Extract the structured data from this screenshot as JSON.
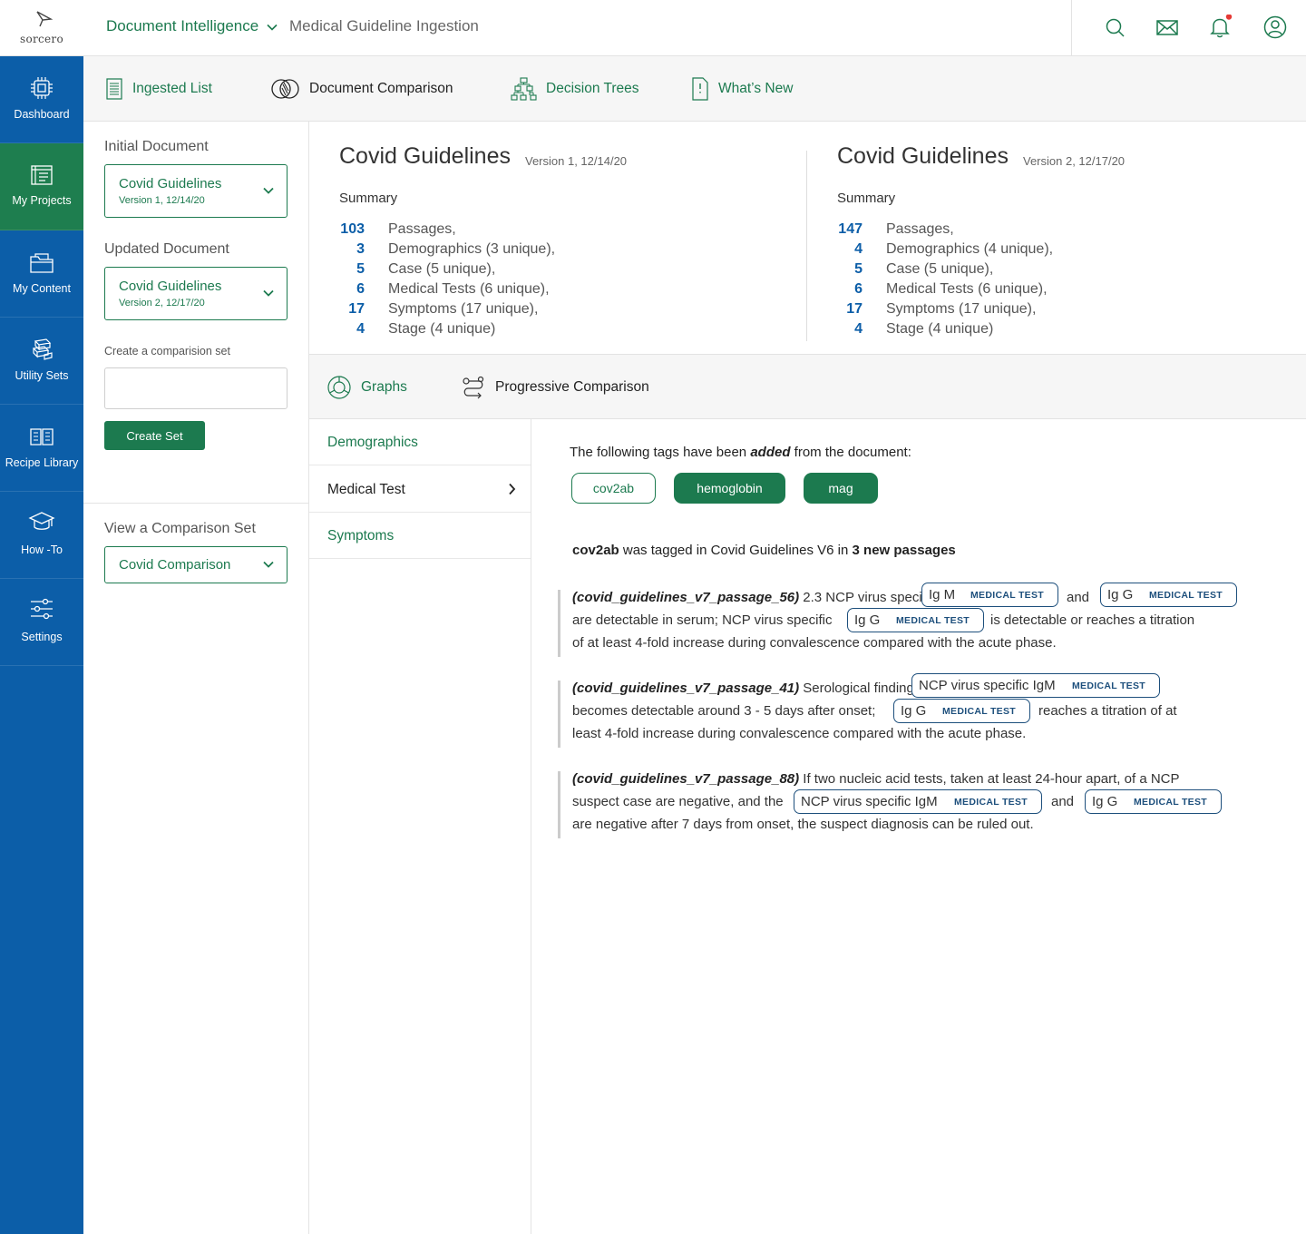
{
  "brand": {
    "logo_text": "sorcero"
  },
  "header": {
    "app_name": "Document Intelligence",
    "page_name": "Medical Guideline Ingestion",
    "icons": [
      "search-icon",
      "mail-icon",
      "bell-icon",
      "user-icon"
    ],
    "notification_dot_color": "#e53935"
  },
  "colors": {
    "brand_green": "#1c7a4f",
    "nav_blue": "#0c5ea8",
    "number_blue": "#0c5ea8",
    "entity_border": "#1d4f7c"
  },
  "nav": {
    "items": [
      {
        "label": "Dashboard",
        "icon": "chip-icon",
        "active": false
      },
      {
        "label": "My Projects",
        "icon": "projects-icon",
        "active": true
      },
      {
        "label": "My Content",
        "icon": "folder-icon",
        "active": false
      },
      {
        "label": "Utility Sets",
        "icon": "stack-icon",
        "active": false
      },
      {
        "label": "Recipe Library",
        "icon": "book-icon",
        "active": false
      },
      {
        "label": "How -To",
        "icon": "graduation-cap-icon",
        "active": false
      },
      {
        "label": "Settings",
        "icon": "sliders-icon",
        "active": false
      }
    ]
  },
  "tabs": [
    {
      "label": "Ingested List",
      "icon": "list-doc-icon",
      "active": false
    },
    {
      "label": "Document Comparison",
      "icon": "compare-icon",
      "active": true
    },
    {
      "label": "Decision Trees",
      "icon": "tree-icon",
      "active": false
    },
    {
      "label": "What’s New",
      "icon": "new-doc-icon",
      "active": false
    }
  ],
  "panel": {
    "initial_label": "Initial Document",
    "initial_doc": {
      "title": "Covid Guidelines",
      "version": "Version 1, 12/14/20"
    },
    "updated_label": "Updated Document",
    "updated_doc": {
      "title": "Covid Guidelines",
      "version": "Version 2, 12/17/20"
    },
    "create_label": "Create a comparision set",
    "create_input_value": "",
    "create_button": "Create Set",
    "view_label": "View a Comparison Set",
    "view_value": "Covid Comparison"
  },
  "summary": {
    "label": "Summary",
    "left": {
      "title": "Covid Guidelines",
      "version": "Version 1, 12/14/20",
      "rows": [
        {
          "num": "103",
          "text": "Passages,"
        },
        {
          "num": "3",
          "text": "Demographics (3 unique),"
        },
        {
          "num": "5",
          "text": "Case (5 unique),"
        },
        {
          "num": "6",
          "text": "Medical Tests (6 unique),"
        },
        {
          "num": "17",
          "text": "Symptoms (17 unique),"
        },
        {
          "num": "4",
          "text": "Stage (4 unique)"
        }
      ]
    },
    "right": {
      "title": "Covid Guidelines",
      "version": "Version 2, 12/17/20",
      "rows": [
        {
          "num": "147",
          "text": "Passages,"
        },
        {
          "num": "4",
          "text": "Demographics (4 unique),"
        },
        {
          "num": "5",
          "text": "Case (5 unique),"
        },
        {
          "num": "6",
          "text": "Medical Tests (6 unique),"
        },
        {
          "num": "17",
          "text": "Symptoms (17 unique),"
        },
        {
          "num": "4",
          "text": "Stage (4 unique)"
        }
      ]
    }
  },
  "graph_tabs": [
    {
      "label": "Graphs",
      "icon": "graph-icon"
    },
    {
      "label": "Progressive Comparison",
      "icon": "progressive-icon"
    }
  ],
  "categories": [
    {
      "label": "Demographics",
      "selected": false
    },
    {
      "label": "Medical Test",
      "selected": true
    },
    {
      "label": "Symptoms",
      "selected": false
    }
  ],
  "detail": {
    "intro_pre": "The following tags have been ",
    "intro_em": "added",
    "intro_post": " from the document:",
    "chips": [
      {
        "label": "cov2ab",
        "style": "outline"
      },
      {
        "label": "hemoglobin",
        "style": "filled"
      },
      {
        "label": "mag",
        "style": "filled"
      }
    ],
    "tagged": {
      "term": "cov2ab",
      "mid": " was tagged in Covid Guidelines V6 in ",
      "count": "3 new passages"
    },
    "entity_tag": "MEDICAL TEST",
    "passages": [
      {
        "id": "(covid_guidelines_v7_passage_56)",
        "l1": " 2.3 NCP virus specific",
        "e1": "Ig M",
        "and": "and",
        "e2": "Ig G",
        "l2a": "are detectable in serum; NCP virus specific",
        "e3": "Ig G",
        "l2b": "is detectable or reaches a titration",
        "l3": "of at least 4-fold increase during convalescence compared with the acute phase."
      },
      {
        "id": "(covid_guidelines_v7_passage_41)",
        "l1": " Serological findings:",
        "e1": "NCP virus specific IgM",
        "l2a": "becomes detectable around 3 - 5 days after onset;",
        "e2": "Ig G",
        "l2b": "reaches a titration of at",
        "l3": "least 4-fold increase during convalescence compared with the acute phase."
      },
      {
        "id": "(covid_guidelines_v7_passage_88)",
        "l1": " If two nucleic acid tests, taken at least 24-hour apart, of a NCP",
        "l2a": "suspect case are negative, and the",
        "e1": "NCP virus specific IgM",
        "and": "and",
        "e2": "Ig G",
        "l3": "are negative after 7 days from onset, the suspect diagnosis can be ruled out."
      }
    ]
  }
}
